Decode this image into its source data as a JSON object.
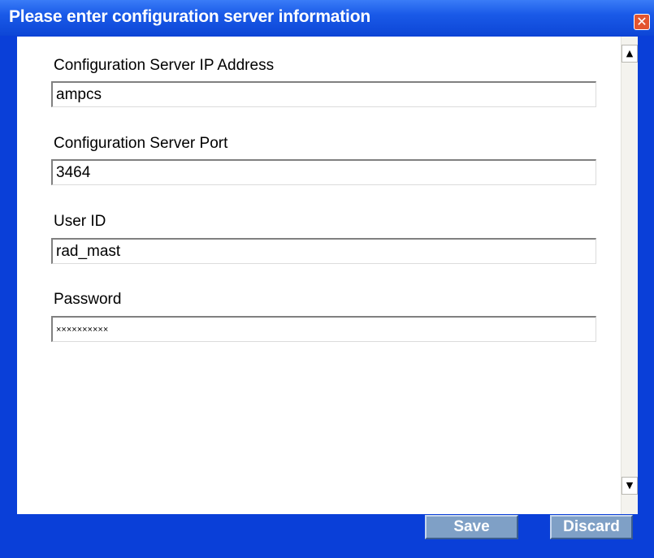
{
  "window": {
    "title": "Please enter configuration server information",
    "close_symbol": "✕"
  },
  "form": {
    "fields": [
      {
        "label": "Configuration Server IP Address",
        "value": "ampcs"
      },
      {
        "label": "Configuration Server Port",
        "value": "3464"
      },
      {
        "label": "User ID",
        "value": "rad_mast"
      },
      {
        "label": "Password",
        "value": "××××××××××"
      }
    ]
  },
  "scrollbar": {
    "up_symbol": "▲",
    "down_symbol": "▼"
  },
  "buttons": {
    "save_label": "Save",
    "discard_label": "Discard"
  },
  "colors": {
    "title_bar": "#1a5ae8",
    "button_face": "#7fa0c6",
    "frame": "#0a3fd8"
  },
  "icons": [
    "close-icon",
    "scroll-up-arrow-icon",
    "scroll-down-arrow-icon"
  ]
}
